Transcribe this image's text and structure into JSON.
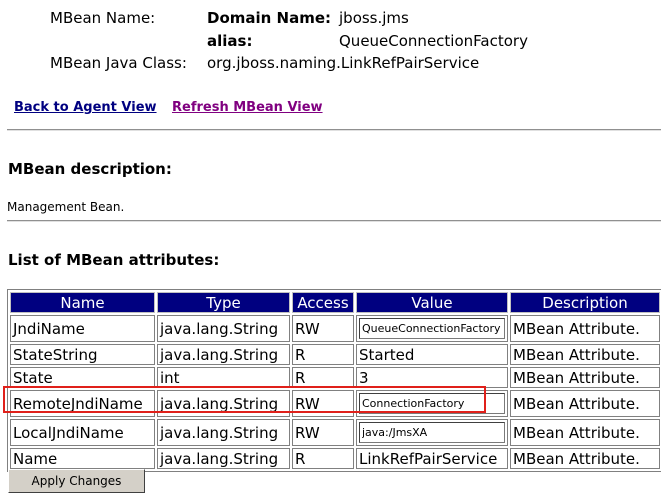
{
  "header": {
    "mbean_name_label": "MBean Name:",
    "domain_name_label": "Domain Name:",
    "domain_name_value": "jboss.jms",
    "alias_label": "alias:",
    "alias_value": "QueueConnectionFactory",
    "java_class_label": "MBean Java Class:",
    "java_class_value": "org.jboss.naming.LinkRefPairService"
  },
  "nav": {
    "back_link": "Back to Agent View",
    "refresh_link": "Refresh MBean View",
    "back_color": "#000080",
    "refresh_color": "#800080"
  },
  "description": {
    "heading": "MBean description:",
    "text": "Management Bean."
  },
  "attributes": {
    "heading": "List of MBean attributes:",
    "columns": [
      "Name",
      "Type",
      "Access",
      "Value",
      "Description"
    ],
    "rows": [
      {
        "name": "JndiName",
        "type": "java.lang.String",
        "access": "RW",
        "value": "QueueConnectionFactory",
        "editable": true,
        "description": "MBean Attribute."
      },
      {
        "name": "StateString",
        "type": "java.lang.String",
        "access": "R",
        "value": "Started",
        "editable": false,
        "description": "MBean Attribute."
      },
      {
        "name": "State",
        "type": "int",
        "access": "R",
        "value": "3",
        "editable": false,
        "description": "MBean Attribute."
      },
      {
        "name": "RemoteJndiName",
        "type": "java.lang.String",
        "access": "RW",
        "value": "ConnectionFactory",
        "editable": true,
        "description": "MBean Attribute."
      },
      {
        "name": "LocalJndiName",
        "type": "java.lang.String",
        "access": "RW",
        "value": "java:/JmsXA",
        "editable": true,
        "description": "MBean Attribute."
      },
      {
        "name": "Name",
        "type": "java.lang.String",
        "access": "R",
        "value": "LinkRefPairService",
        "editable": false,
        "description": "MBean Attribute."
      }
    ],
    "header_bg": "#000080",
    "highlight_color": "#e0201a"
  },
  "apply_button": "Apply Changes"
}
